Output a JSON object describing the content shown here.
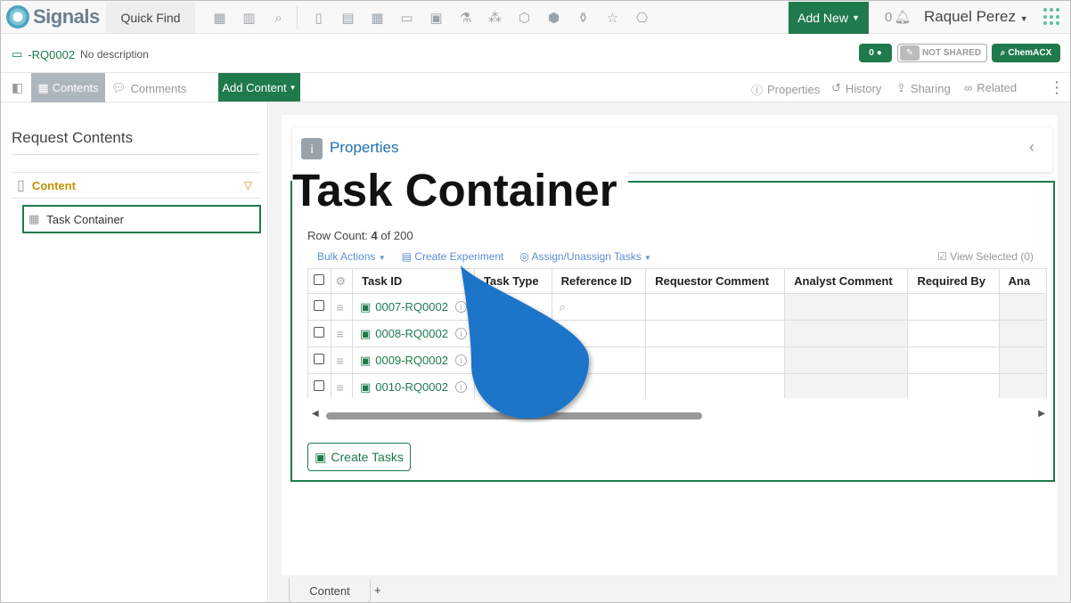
{
  "topbar": {
    "app_name": "Signals",
    "quick_find": "Quick Find",
    "add_new": "Add New",
    "notifications_count": "0",
    "user_name": "Raquel Perez"
  },
  "record": {
    "id": "-RQ0002",
    "description": "No description",
    "comments_count": "0",
    "shared_status": "NOT SHARED",
    "chemacx": "ChemACX"
  },
  "tabbar": {
    "contents": "Contents",
    "comments": "Comments",
    "add_content": "Add Content",
    "properties": "Properties",
    "history": "History",
    "sharing": "Sharing",
    "related": "Related"
  },
  "left": {
    "title": "Request Contents",
    "section": "Content",
    "item": "Task Container"
  },
  "properties_title": "Properties",
  "task_container": {
    "title": "Task Container",
    "row_count_label": "Row Count:",
    "row_count": "4",
    "row_count_of": "of 200",
    "bulk_actions": "Bulk Actions",
    "create_experiment": "Create Experiment",
    "assign_tasks": "Assign/Unassign Tasks",
    "view_selected": "View Selected (0)",
    "columns": [
      "Task ID",
      "Task Type",
      "Reference ID",
      "Requestor Comment",
      "Analyst Comment",
      "Required By",
      "Ana"
    ],
    "rows": [
      {
        "task_id": "0007-RQ0002"
      },
      {
        "task_id": "0008-RQ0002"
      },
      {
        "task_id": "0009-RQ0002"
      },
      {
        "task_id": "0010-RQ0002"
      }
    ],
    "create_tasks": "Create Tasks"
  },
  "bottom_tab": "Content",
  "bottom_plus": "+",
  "colors": {
    "brand_green": "#1f7a4d",
    "link_blue": "#1f6fb0",
    "drop_blue": "#1e74c8",
    "content_gold": "#c29100"
  }
}
